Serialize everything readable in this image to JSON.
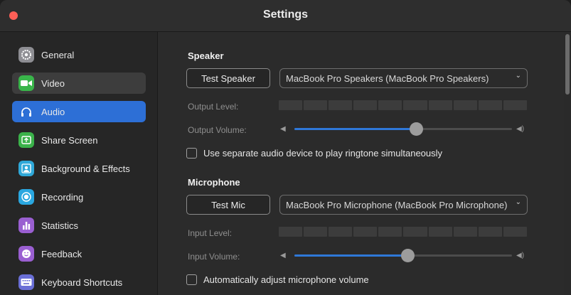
{
  "window": {
    "title": "Settings"
  },
  "sidebar": {
    "items": [
      {
        "label": "General",
        "icon": "gear-icon",
        "color": "#8e8e93",
        "state": "normal"
      },
      {
        "label": "Video",
        "icon": "video-camera-icon",
        "color": "#39b54a",
        "state": "hover"
      },
      {
        "label": "Audio",
        "icon": "headphones-icon",
        "color": "#2d6fd6",
        "state": "active"
      },
      {
        "label": "Share Screen",
        "icon": "share-screen-icon",
        "color": "#3bb24a",
        "state": "normal"
      },
      {
        "label": "Background & Effects",
        "icon": "person-background-icon",
        "color": "#2fa8d8",
        "state": "normal"
      },
      {
        "label": "Recording",
        "icon": "record-icon",
        "color": "#2aa7e0",
        "state": "normal"
      },
      {
        "label": "Statistics",
        "icon": "bar-chart-icon",
        "color": "#9a5fd1",
        "state": "normal"
      },
      {
        "label": "Feedback",
        "icon": "smiley-icon",
        "color": "#9a5fd1",
        "state": "normal"
      },
      {
        "label": "Keyboard Shortcuts",
        "icon": "keyboard-icon",
        "color": "#6a6fd6",
        "state": "normal"
      }
    ]
  },
  "speaker": {
    "title": "Speaker",
    "test_button": "Test Speaker",
    "device": "MacBook Pro Speakers (MacBook Pro Speakers)",
    "output_level_label": "Output Level:",
    "output_volume_label": "Output Volume:",
    "output_volume": 0.56,
    "level_segments": 10
  },
  "ringtone": {
    "label": "Use separate audio device to play ringtone simultaneously",
    "checked": false
  },
  "microphone": {
    "title": "Microphone",
    "test_button": "Test Mic",
    "device": "MacBook Pro Microphone (MacBook Pro Microphone)",
    "input_level_label": "Input Level:",
    "input_volume_label": "Input Volume:",
    "input_volume": 0.52,
    "level_segments": 10
  },
  "auto_adjust": {
    "label": "Automatically adjust microphone volume",
    "checked": false
  },
  "colors": {
    "accent": "#2f78d8",
    "close": "#fe5f57"
  }
}
